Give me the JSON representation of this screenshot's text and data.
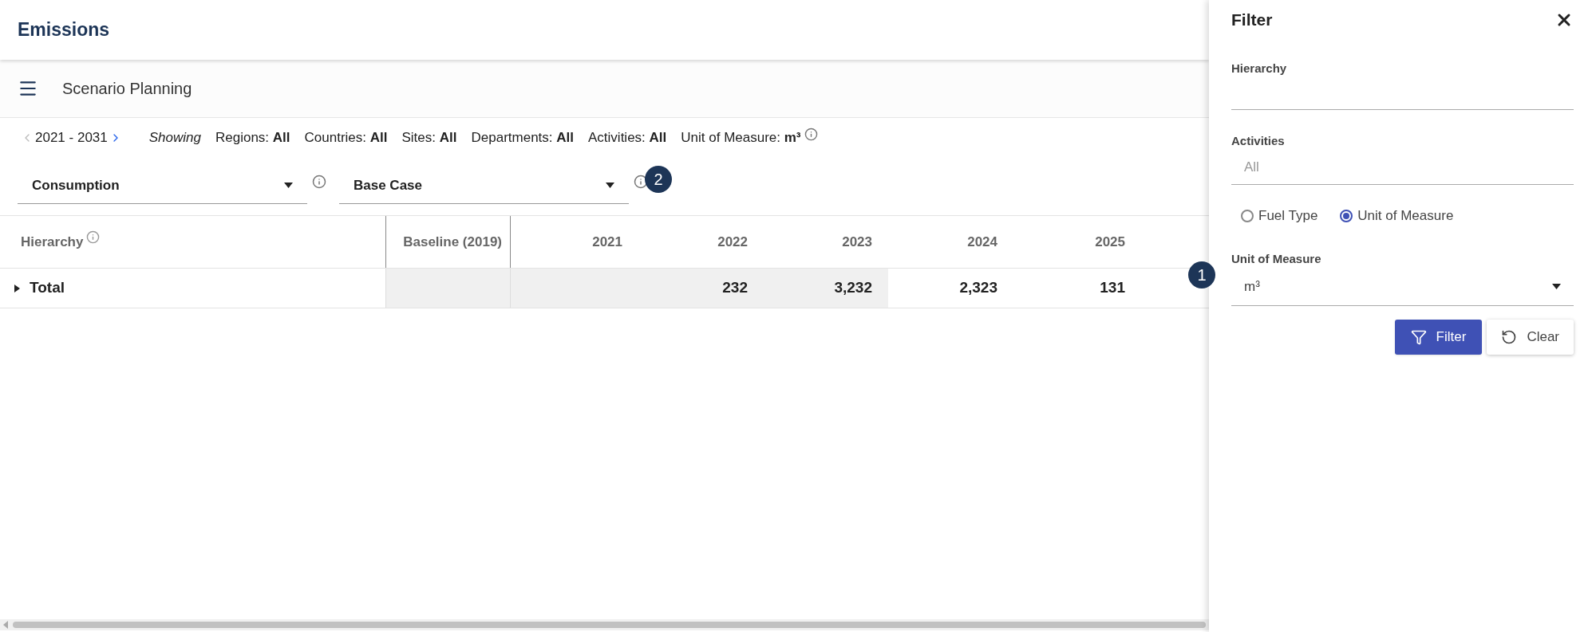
{
  "app_bar": {
    "title": "Emissions"
  },
  "toolbar": {
    "title": "Scenario Planning"
  },
  "filter_summary": {
    "range": "2021 - 2031",
    "showing": "Showing",
    "items": [
      {
        "label": "Regions:",
        "value": "All"
      },
      {
        "label": "Countries:",
        "value": "All"
      },
      {
        "label": "Sites:",
        "value": "All"
      },
      {
        "label": "Departments:",
        "value": "All"
      },
      {
        "label": "Activities:",
        "value": "All"
      },
      {
        "label": "Unit of Measure:",
        "value": "m³"
      }
    ]
  },
  "selects": [
    {
      "value": "Consumption"
    },
    {
      "value": "Base Case"
    }
  ],
  "table": {
    "columns": [
      "Hierarchy",
      "Baseline (2019)",
      "2021",
      "2022",
      "2023",
      "2024",
      "2025"
    ],
    "rows": [
      {
        "expanded": false,
        "cells": [
          {
            "text": "Total",
            "shaded": false
          },
          {
            "text": "",
            "shaded": true
          },
          {
            "text": "",
            "shaded": true
          },
          {
            "text": "232",
            "shaded": true
          },
          {
            "text": "3,232",
            "shaded": true
          },
          {
            "text": "2,323",
            "shaded": false
          },
          {
            "text": "131",
            "shaded": false
          }
        ]
      }
    ]
  },
  "filter_panel": {
    "title": "Filter",
    "hierarchy": {
      "label": "Hierarchy"
    },
    "activities": {
      "label": "Activities",
      "placeholder": "All"
    },
    "radios": [
      {
        "label": "Fuel Type",
        "selected": false
      },
      {
        "label": "Unit of Measure",
        "selected": true
      }
    ],
    "unit": {
      "label": "Unit of Measure",
      "value": "m³"
    },
    "buttons": [
      {
        "kind": "primary",
        "label": "Filter"
      },
      {
        "kind": "secondary",
        "label": "Clear"
      }
    ]
  },
  "annotations": [
    {
      "number": "1"
    },
    {
      "number": "2"
    }
  ]
}
